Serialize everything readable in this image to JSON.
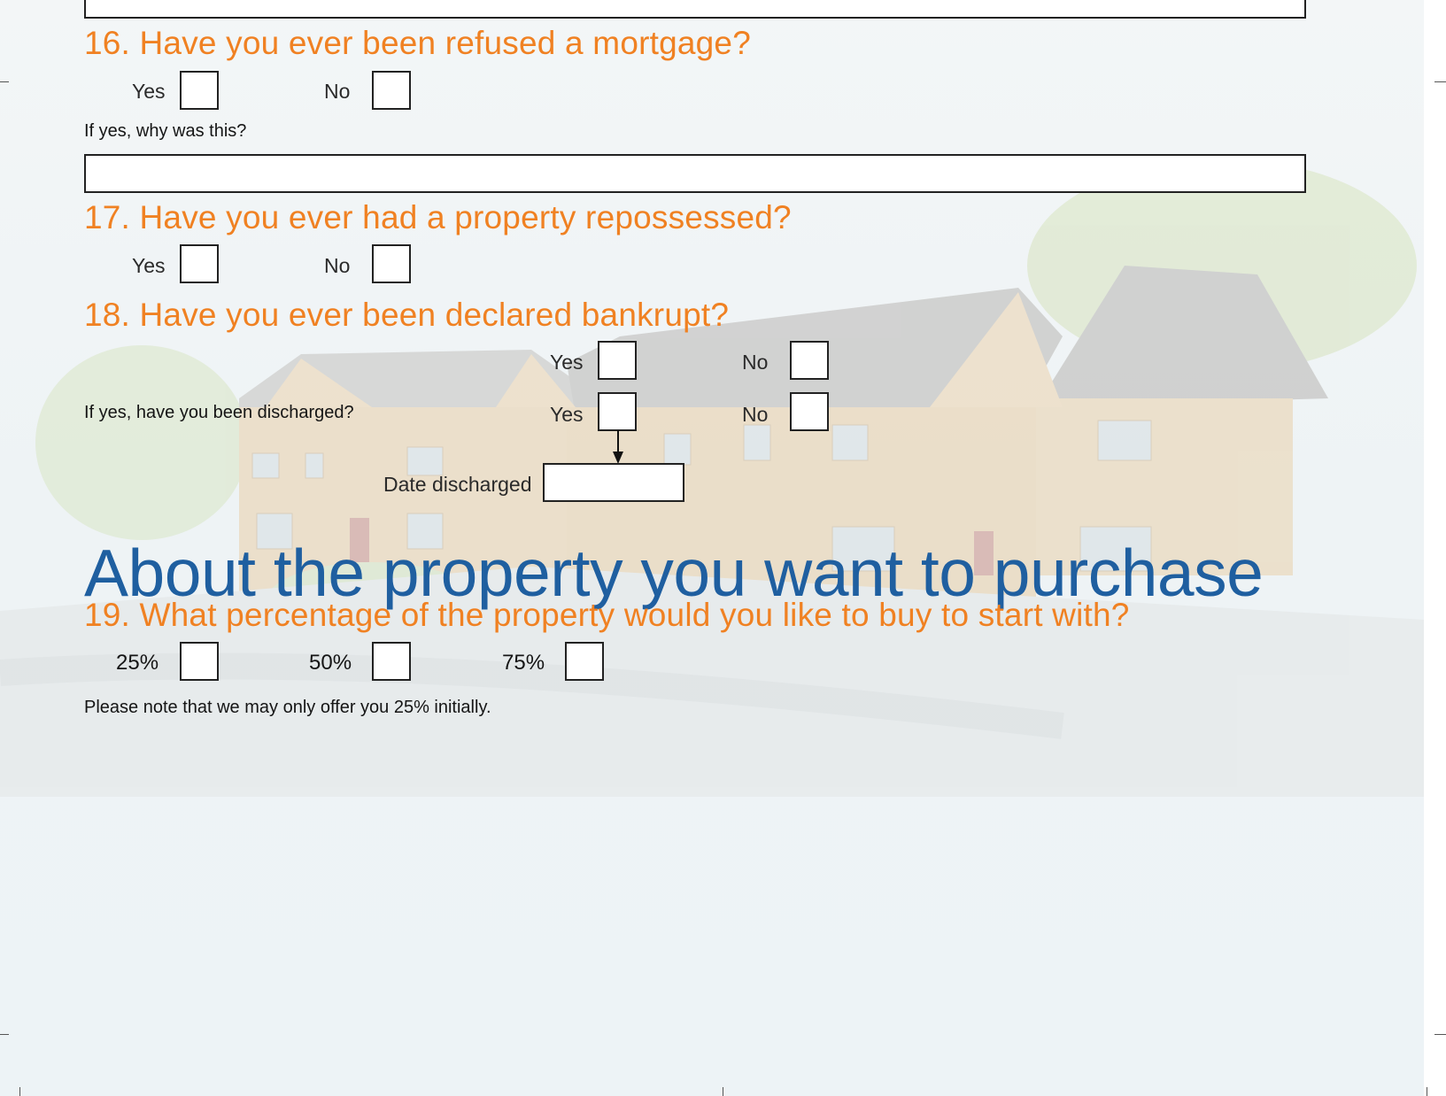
{
  "colors": {
    "question": "#f08122",
    "section_heading": "#1f5fa0",
    "box_border": "#222222"
  },
  "q16": {
    "title": "16. Have you ever been refused a mortgage?",
    "yes_label": "Yes",
    "no_label": "No",
    "follow_up": "If yes, why was this?"
  },
  "q17": {
    "title": "17. Have you ever had a property repossessed?",
    "yes_label": "Yes",
    "no_label": "No"
  },
  "q18": {
    "title": "18. Have you ever been declared bankrupt?",
    "yes_label": "Yes",
    "no_label": "No",
    "discharged_question": "If yes, have you been discharged?",
    "discharged_yes_label": "Yes",
    "discharged_no_label": "No",
    "date_label": "Date discharged"
  },
  "section": {
    "title": "About the property you want to purchase"
  },
  "q19": {
    "title": "19. What percentage of the property would you like to buy to start with?",
    "options": [
      "25%",
      "50%",
      "75%"
    ],
    "note": "Please note that we may only offer you 25% initially."
  }
}
